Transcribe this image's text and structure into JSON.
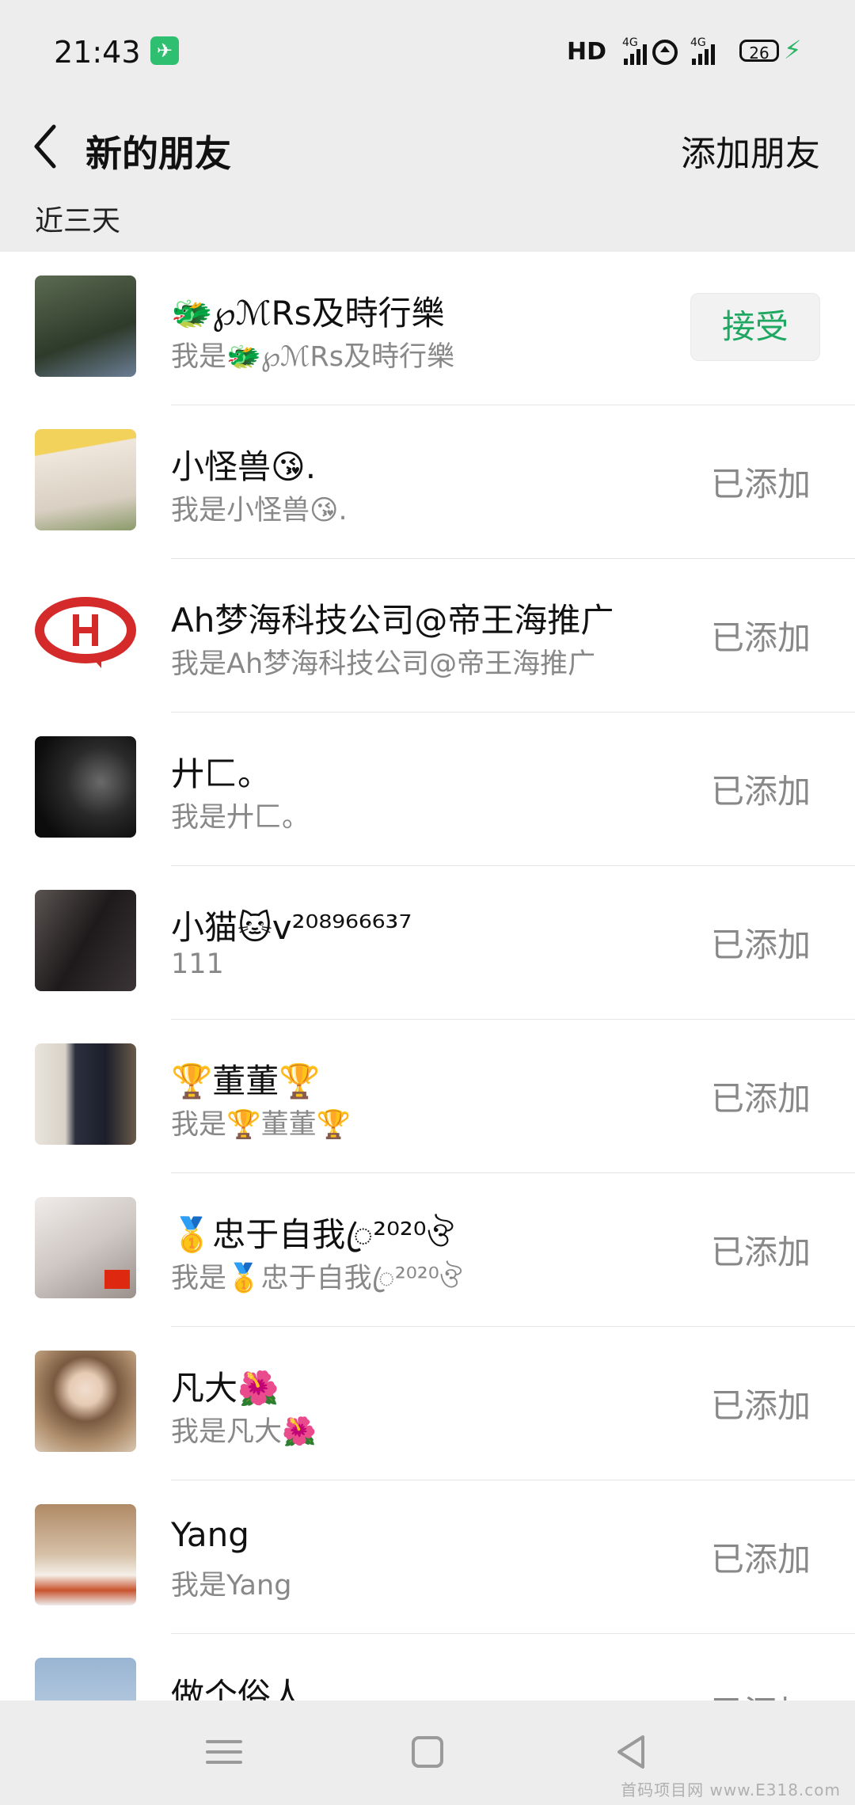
{
  "status_bar": {
    "time": "21:43",
    "network": "HD",
    "signal1_label": "4G",
    "signal2_label": "4G",
    "battery_level": "26",
    "icons": [
      "airplane-mode-icon",
      "hd-icon",
      "signal-icon",
      "wifi-icon",
      "signal-icon",
      "battery-icon",
      "charging-icon"
    ]
  },
  "header": {
    "title": "新的朋友",
    "add_friend": "添加朋友"
  },
  "section_label": "近三天",
  "accept_label": "接受",
  "added_label": "已添加",
  "contacts": [
    {
      "name": "🐲℘ℳRs及時行樂",
      "request": "我是🐲℘ℳRs及時行樂",
      "state": "pending",
      "avatar_color": "#3c4a3a"
    },
    {
      "name": "小怪兽😘.",
      "request": "我是小怪兽😘.",
      "state": "added",
      "avatar_color": "#cfc6b8"
    },
    {
      "name": "Ah梦海科技公司@帝王海推广",
      "request": "我是Ah梦海科技公司@帝王海推广",
      "state": "added",
      "avatar_color": "#ffffff"
    },
    {
      "name": "廾匚。",
      "request": "我是廾匚。",
      "state": "added",
      "avatar_color": "#1c1c1c"
    },
    {
      "name": "小猫🐱v²⁰⁸⁹⁶⁶⁶³⁷",
      "request": "111",
      "state": "added",
      "avatar_color": "#2a2426"
    },
    {
      "name": "🏆董董🏆",
      "request": "我是🏆董董🏆",
      "state": "added",
      "avatar_color": "#2c2f3e"
    },
    {
      "name": "🥇忠于自我ꦿ²⁰²⁰ঔ",
      "request": "我是🥇忠于自我ꦿ²⁰²⁰ঔ",
      "state": "added",
      "avatar_color": "#d9d4d2"
    },
    {
      "name": "凡大🌺",
      "request": "我是凡大🌺",
      "state": "added",
      "avatar_color": "#c5a98a"
    },
    {
      "name": "Yang",
      "request": "我是Yang",
      "state": "added",
      "avatar_color": "#b68f6e"
    },
    {
      "name": "做个俗人",
      "request": "",
      "state": "added",
      "avatar_color": "#9ab5d2"
    }
  ],
  "watermark": "首码项目网 www.E318.com"
}
